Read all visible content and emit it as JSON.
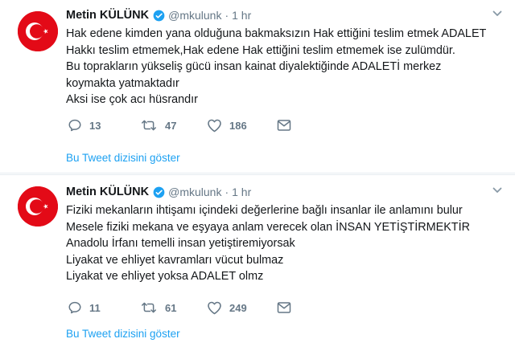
{
  "tweets": [
    {
      "name": "Metin KÜLÜNK",
      "handle": "@mkulunk",
      "separator": "·",
      "time": "1 hr",
      "lines": [
        "Hak edene kimden yana olduğuna bakmaksızın Hak ettiğini teslim etmek ADALET",
        "Hakkı teslim etmemek,Hak edene Hak ettiğini teslim etmemek ise zulümdür.",
        "Bu toprakların yükseliş gücü insan kainat diyalektiğinde ADALETİ merkez",
        "koymakta yatmaktadır",
        "Aksi ise çok acı hüsrandır"
      ],
      "replies": "13",
      "retweets": "47",
      "likes": "186",
      "thread_link": "Bu Tweet dizisini göster"
    },
    {
      "name": "Metin KÜLÜNK",
      "handle": "@mkulunk",
      "separator": "·",
      "time": "1 hr",
      "lines": [
        "Fiziki mekanların ihtişamı içindeki değerlerine bağlı insanlar ile anlamını bulur",
        "Mesele fiziki mekana ve eşyaya anlam verecek olan İNSAN YETİŞTİRMEKTİR",
        "Anadolu İrfanı temelli insan yetiştiremiyorsak",
        "Liyakat ve ehliyet kavramları vücut bulmaz",
        "Liyakat ve ehliyet yoksa ADALET olmz"
      ],
      "replies": "11",
      "retweets": "61",
      "likes": "249",
      "thread_link": "Bu Tweet dizisini göster"
    }
  ],
  "colors": {
    "link": "#1da1f2",
    "muted": "#657786",
    "avatar_red": "#e30a17"
  },
  "icons": [
    "turkish-flag-avatar",
    "verified-badge-icon",
    "chevron-down-icon",
    "reply-icon",
    "retweet-icon",
    "like-icon",
    "message-icon"
  ]
}
